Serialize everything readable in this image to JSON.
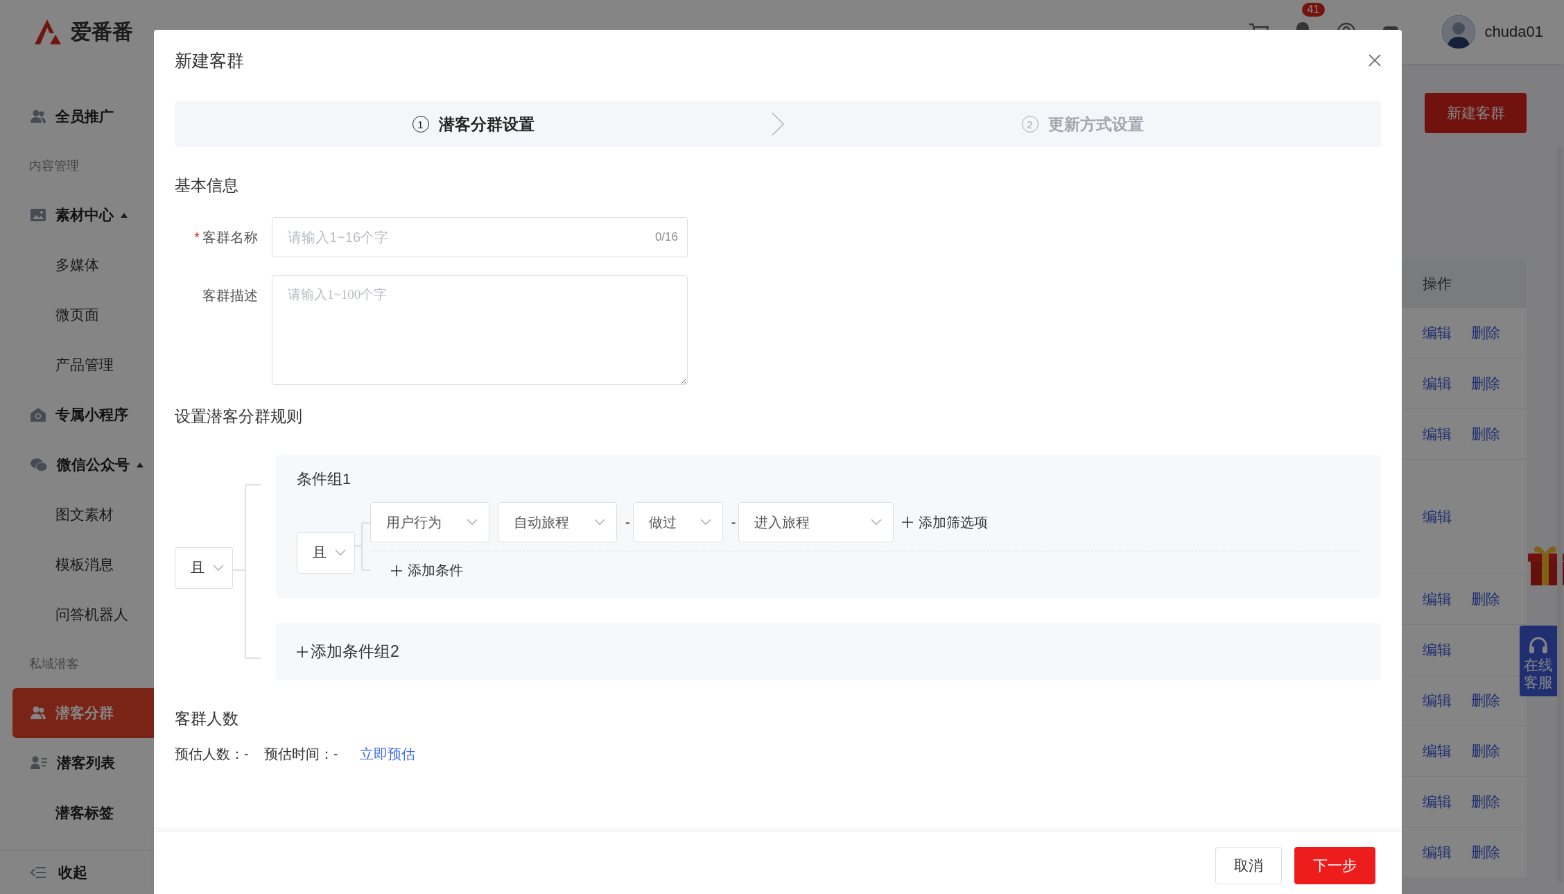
{
  "header": {
    "logo": "爱番番",
    "notification_badge": "41",
    "username": "chuda01"
  },
  "sidebar": {
    "items": [
      {
        "kind": "group",
        "label": "全员推广",
        "selected": false
      },
      {
        "kind": "section",
        "label": "内容管理"
      },
      {
        "kind": "group",
        "label": "素材中心",
        "selected": false,
        "expanded": true
      },
      {
        "kind": "sub",
        "label": "多媒体",
        "selected": false
      },
      {
        "kind": "sub",
        "label": "微页面",
        "selected": false
      },
      {
        "kind": "sub",
        "label": "产品管理",
        "selected": false
      },
      {
        "kind": "group",
        "label": "专属小程序",
        "selected": false
      },
      {
        "kind": "group",
        "label": "微信公众号",
        "selected": false,
        "expanded": true
      },
      {
        "kind": "sub",
        "label": "图文素材",
        "selected": false
      },
      {
        "kind": "sub",
        "label": "模板消息",
        "selected": false
      },
      {
        "kind": "sub",
        "label": "问答机器人",
        "selected": false
      },
      {
        "kind": "section",
        "label": "私域潜客"
      },
      {
        "kind": "group",
        "label": "潜客分群",
        "selected": true
      },
      {
        "kind": "group",
        "label": "潜客列表",
        "selected": false
      },
      {
        "kind": "group",
        "label": "潜客标签",
        "selected": false
      }
    ],
    "collapse": "收起"
  },
  "page": {
    "new_button": "新建客群",
    "table": {
      "columns": [
        "操作"
      ],
      "rows": [
        {
          "actions": [
            "编辑",
            "删除"
          ]
        },
        {
          "actions": [
            "编辑",
            "删除"
          ]
        },
        {
          "actions": [
            "编辑",
            "删除"
          ]
        },
        {
          "actions": [
            "编辑"
          ],
          "tall": true
        },
        {
          "actions": [
            "编辑",
            "删除"
          ]
        },
        {
          "actions": [
            "编辑"
          ]
        },
        {
          "actions": [
            "编辑",
            "删除"
          ]
        },
        {
          "actions": [
            "编辑",
            "删除"
          ]
        },
        {
          "actions": [
            "编辑",
            "删除"
          ]
        },
        {
          "actions": [
            "编辑",
            "删除"
          ]
        }
      ]
    },
    "support_widget": "在线客服"
  },
  "dialog": {
    "title": "新建客群",
    "steps": [
      {
        "number": "1",
        "label": "潜客分群设置",
        "selected": true
      },
      {
        "number": "2",
        "label": "更新方式设置",
        "selected": false
      }
    ],
    "basic_info": {
      "heading": "基本信息",
      "fields": [
        {
          "kind": "input",
          "label": "客群名称",
          "required_mark": "*",
          "placeholder": "请输入1~16个字",
          "counter": "0/16"
        },
        {
          "kind": "textarea",
          "label": "客群描述",
          "placeholder": "请输入1~100个字"
        }
      ]
    },
    "rules": {
      "heading": "设置潜客分群规则",
      "logic": "且",
      "groups": [
        {
          "title": "条件组1",
          "logic": "且",
          "conditions": [
            {
              "selects": [
                {
                  "value": "用户行为"
                },
                {
                  "value": "自动旅程"
                },
                {
                  "prefix": "-",
                  "value": "做过"
                },
                {
                  "prefix": "-",
                  "value": "进入旅程"
                }
              ],
              "add_filter": "添加筛选项"
            }
          ],
          "add_condition": "添加条件"
        }
      ],
      "add_group": "添加条件组2"
    },
    "audience": {
      "heading": "客群人数",
      "estimated_count": "预估人数：-",
      "estimated_time": "预估时间：-",
      "estimate_link": "立即预估"
    },
    "buttons": [
      {
        "kind": "default",
        "label": "取消"
      },
      {
        "kind": "primary",
        "label": "下一步"
      }
    ]
  }
}
